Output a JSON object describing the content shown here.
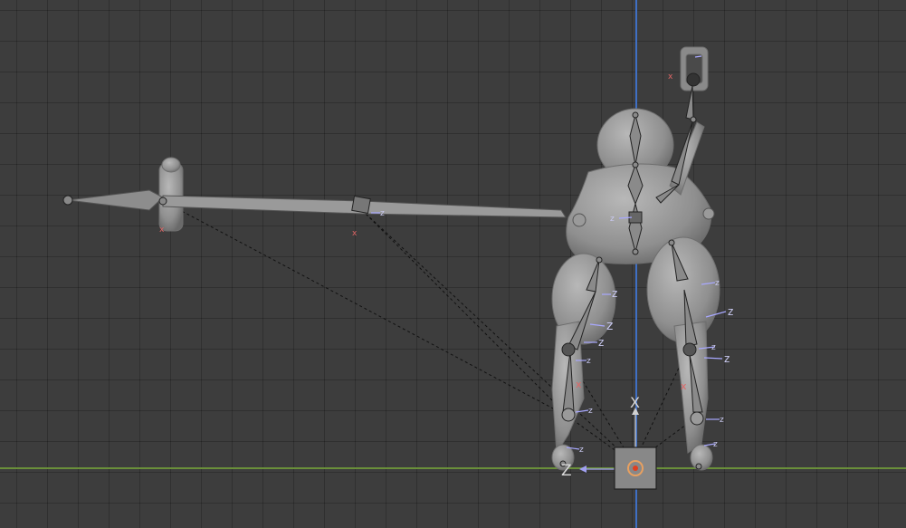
{
  "viewport": {
    "background_color": "#3d3d3d",
    "grid_color": "#333333",
    "x_axis_color": "#6a8f3a",
    "y_axis_color": "#3f6fc4"
  },
  "gizmo": {
    "x_label": "X",
    "z_label": "Z",
    "x_color": "#d0d0d0",
    "z_color": "#a0a0f0"
  },
  "bone_axis_labels": {
    "z": "z",
    "x": "x"
  },
  "mesh": {
    "color": "#9a9a9a",
    "outline_color": "#6e6e6e"
  }
}
